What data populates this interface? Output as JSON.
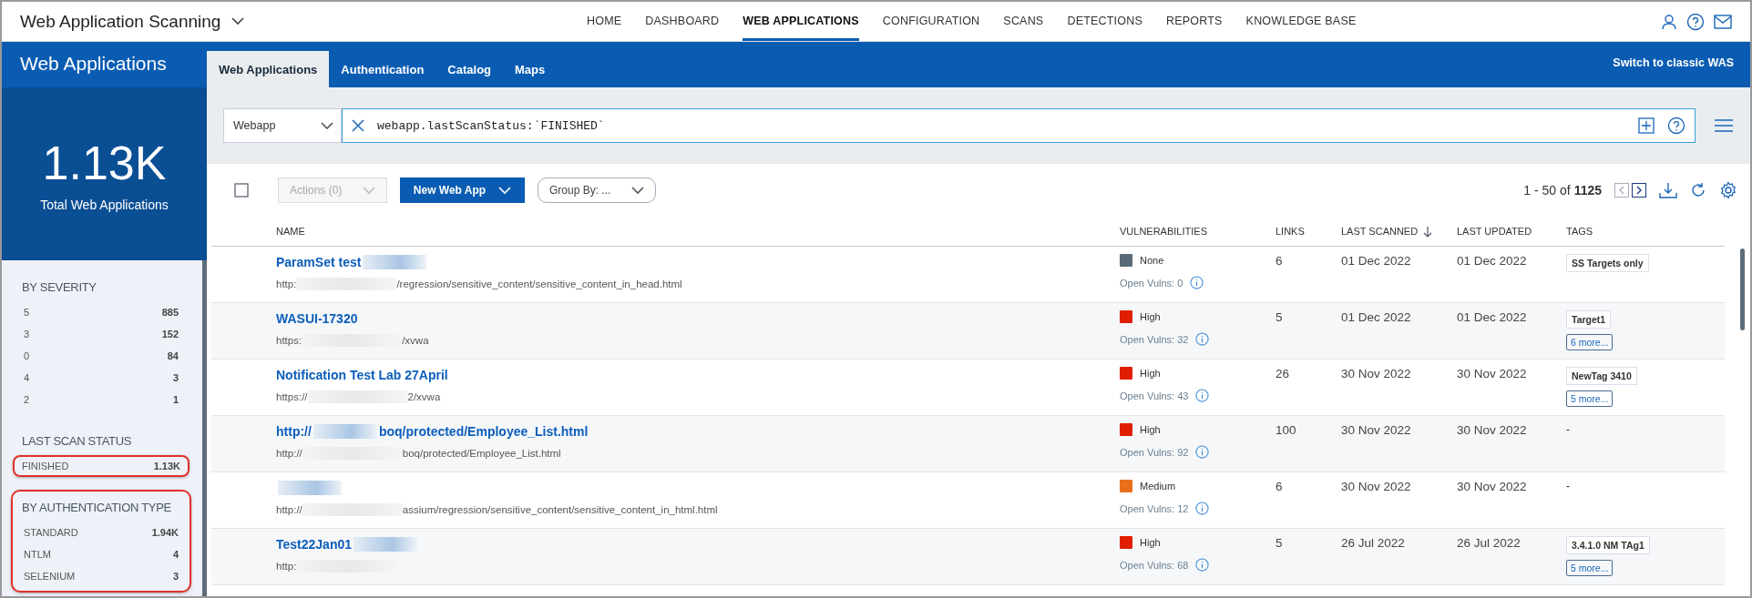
{
  "app": {
    "title": "Web Application Scanning"
  },
  "nav": [
    {
      "label": "HOME",
      "selected": false
    },
    {
      "label": "DASHBOARD",
      "selected": false
    },
    {
      "label": "WEB APPLICATIONS",
      "selected": true
    },
    {
      "label": "CONFIGURATION",
      "selected": false
    },
    {
      "label": "SCANS",
      "selected": false
    },
    {
      "label": "DETECTIONS",
      "selected": false
    },
    {
      "label": "REPORTS",
      "selected": false
    },
    {
      "label": "KNOWLEDGE BASE",
      "selected": false
    }
  ],
  "sidebar": {
    "title": "Web Applications",
    "total": "1.13K",
    "total_label": "Total Web Applications",
    "groups": [
      {
        "title": "BY SEVERITY",
        "highlighted": false,
        "items": [
          {
            "label": "5",
            "count": "885",
            "highlighted": false
          },
          {
            "label": "3",
            "count": "152",
            "highlighted": false
          },
          {
            "label": "0",
            "count": "84",
            "highlighted": false
          },
          {
            "label": "4",
            "count": "3",
            "highlighted": false
          },
          {
            "label": "2",
            "count": "1",
            "highlighted": false
          }
        ]
      },
      {
        "title": "LAST SCAN STATUS",
        "highlighted": false,
        "items": [
          {
            "label": "FINISHED",
            "count": "1.13K",
            "highlighted": true
          }
        ]
      },
      {
        "title": "BY AUTHENTICATION TYPE",
        "highlighted": true,
        "items": [
          {
            "label": "STANDARD",
            "count": "1.94K",
            "highlighted": false
          },
          {
            "label": "NTLM",
            "count": "4",
            "highlighted": false
          },
          {
            "label": "SELENIUM",
            "count": "3",
            "highlighted": false
          }
        ]
      }
    ]
  },
  "tabs": [
    {
      "label": "Web Applications",
      "selected": true
    },
    {
      "label": "Authentication",
      "selected": false
    },
    {
      "label": "Catalog",
      "selected": false
    },
    {
      "label": "Maps",
      "selected": false
    }
  ],
  "switch_link": "Switch to classic WAS",
  "search": {
    "scope": "Webapp",
    "query": "webapp.lastScanStatus:`FINISHED`"
  },
  "select_all": {
    "checked": false
  },
  "toolbar": {
    "actions": "Actions (0)",
    "actions_disabled": true,
    "new_button": "New Web App",
    "group_by": "Group By: ...",
    "range": "1 - 50 of",
    "total": "1125"
  },
  "table": {
    "columns": [
      {
        "label": "NAME",
        "sorted": false
      },
      {
        "label": "VULNERABILITIES",
        "sorted": false
      },
      {
        "label": "LINKS",
        "sorted": false
      },
      {
        "label": "LAST SCANNED",
        "sorted": true
      },
      {
        "label": "LAST UPDATED",
        "sorted": false
      },
      {
        "label": "TAGS",
        "sorted": false
      }
    ],
    "rows": [
      {
        "name": [
          {
            "kind": "text",
            "text": "ParamSet test"
          },
          {
            "kind": "redaction"
          }
        ],
        "url": [
          {
            "kind": "text",
            "text": "http:"
          },
          {
            "kind": "redaction"
          },
          {
            "kind": "text",
            "text": "/regression/sensitive_content/sensitive_content_in_head.html"
          }
        ],
        "severity": "None",
        "color": "#5a6b78",
        "open_vulns": "Open Vulns: 0",
        "links": "6",
        "last_scanned": "01 Dec 2022",
        "last_updated": "01 Dec 2022",
        "tags": [
          "SS Targets only"
        ]
      },
      {
        "name": [
          {
            "kind": "text",
            "text": "WASUI-17320"
          }
        ],
        "url": [
          {
            "kind": "text",
            "text": "https:"
          },
          {
            "kind": "redaction"
          },
          {
            "kind": "text",
            "text": "/xvwa"
          }
        ],
        "severity": "High",
        "color": "#e01e00",
        "open_vulns": "Open Vulns: 32",
        "links": "5",
        "last_scanned": "01 Dec 2022",
        "last_updated": "01 Dec 2022",
        "tags": [
          "Target1"
        ],
        "more": "6 more..."
      },
      {
        "name": [
          {
            "kind": "text",
            "text": "Notification Test Lab 27April"
          }
        ],
        "url": [
          {
            "kind": "text",
            "text": "https://"
          },
          {
            "kind": "redaction"
          },
          {
            "kind": "text",
            "text": "2/xvwa"
          }
        ],
        "severity": "High",
        "color": "#e01e00",
        "open_vulns": "Open Vulns: 43",
        "links": "26",
        "last_scanned": "30 Nov 2022",
        "last_updated": "30 Nov 2022",
        "tags": [
          "NewTag 3410"
        ],
        "more": "5 more..."
      },
      {
        "name": [
          {
            "kind": "text",
            "text": "http://"
          },
          {
            "kind": "redaction"
          },
          {
            "kind": "text",
            "text": "boq/protected/Employee_List.html"
          }
        ],
        "url": [
          {
            "kind": "text",
            "text": "http://"
          },
          {
            "kind": "redaction"
          },
          {
            "kind": "text",
            "text": "boq/protected/Employee_List.html"
          }
        ],
        "severity": "High",
        "color": "#e01e00",
        "open_vulns": "Open Vulns: 92",
        "links": "100",
        "last_scanned": "30 Nov 2022",
        "last_updated": "30 Nov 2022",
        "no_tags": "-"
      },
      {
        "name": [
          {
            "kind": "redaction"
          }
        ],
        "url": [
          {
            "kind": "text",
            "text": "http://"
          },
          {
            "kind": "redaction"
          },
          {
            "kind": "text",
            "text": "assium/regression/sensitive_content/sensitive_content_in_html.html"
          }
        ],
        "severity": "Medium",
        "color": "#e8701a",
        "open_vulns": "Open Vulns: 12",
        "links": "6",
        "last_scanned": "30 Nov 2022",
        "last_updated": "30 Nov 2022",
        "no_tags": "-"
      },
      {
        "name": [
          {
            "kind": "text",
            "text": "Test22Jan01"
          },
          {
            "kind": "redaction"
          }
        ],
        "url": [
          {
            "kind": "text",
            "text": "http:"
          },
          {
            "kind": "redaction"
          }
        ],
        "severity": "High",
        "color": "#e01e00",
        "open_vulns": "Open Vulns: 68",
        "links": "5",
        "last_scanned": "26 Jul 2022",
        "last_updated": "26 Jul 2022",
        "tags": [
          "3.4.1.0 NM TAg1"
        ],
        "more": "5 more..."
      }
    ]
  }
}
